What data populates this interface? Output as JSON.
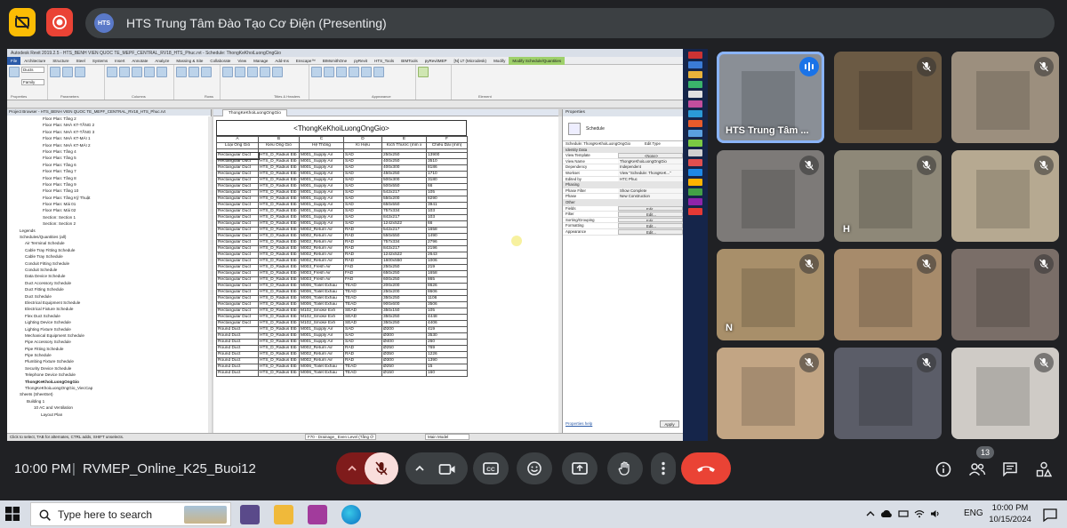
{
  "presentation": {
    "title": "HTS Trung Tâm Đào Tạo Cơ Điện (Presenting)",
    "logo_text": "HTS"
  },
  "revit": {
    "title_bar": "Autodesk Revit 2019.2.5 - HTS_BENH VIEN QUOC TE_MEPF_CENTRAL_RV18_HTS_Phuc.rvt - Schedule: ThongKeKhoiLuongOngGio",
    "tabs": [
      "File",
      "Architecture",
      "Structure",
      "Steel",
      "Systems",
      "Insert",
      "Annotate",
      "Analyze",
      "Massing & Site",
      "Collaborate",
      "View",
      "Manage",
      "Add-Ins",
      "Enscape™",
      "BIMsmithOne",
      "pyRevit",
      "HTS_Tools",
      "BIMTools",
      "pyRevitMEP",
      "[N] LT (Microdesk)",
      "Modify",
      "Modify Schedule/Quantities"
    ],
    "ribbon_groups": [
      "Properties",
      "Parameters",
      "Columns",
      "Rows",
      "Titles & Headers",
      "Appearance",
      "Element"
    ],
    "ribbon_dropdown_1": "Ducts",
    "ribbon_dropdown_2": "Family",
    "browser_header": "Project Browser - HTS_BENH VIEN QUOC TE_MEPF_CENTRAL_RV18_HTS_Phuc.rvt",
    "browser_items": [
      "Floor Plan: Tầng 2",
      "Floor Plan: NHÀ KT-TẦNG 2",
      "Floor Plan: NHÀ KT-TẦNG 3",
      "Floor Plan: NHÀ KT-MÁI 1",
      "Floor Plan: NHÀ KT-MÁI 2",
      "Floor Plan: Tầng 4",
      "Floor Plan: Tầng 5",
      "Floor Plan: Tầng 6",
      "Floor Plan: Tầng 7",
      "Floor Plan: Tầng 8",
      "Floor Plan: Tầng 9",
      "Floor Plan: Tầng 10",
      "Floor Plan: Tầng Kỹ Thuật",
      "Floor Plan: Mái 01",
      "Floor Plan: Mái 02",
      "Section: Section 1",
      "Section: Section 2",
      "Legends",
      "Schedules/Quantities (all)",
      "Air Terminal Schedule",
      "Cable Tray Fitting Schedule",
      "Cable Tray Schedule",
      "Conduit Fitting Schedule",
      "Conduit Schedule",
      "Data Device Schedule",
      "Duct Accessory Schedule",
      "Duct Fitting Schedule",
      "Duct Schedule",
      "Electrical Equipment Schedule",
      "Electrical Fixture Schedule",
      "Flex Duct Schedule",
      "Lighting Device Schedule",
      "Lighting Fixture Schedule",
      "Mechanical Equipment Schedule",
      "Pipe Accessory Schedule",
      "Pipe Fitting Schedule",
      "Pipe Schedule",
      "Plumbing Fixture Schedule",
      "Security Device Schedule",
      "Telephone Device Schedule",
      "ThongKeKhoiLuongOngGio",
      "ThongKeKhoiLuongOngGio_ViecCap",
      "Sheets (SheetSet)",
      "Building 1",
      "10 AC and Ventilation",
      "Layout Plan"
    ],
    "view_tab": "ThongKeKhoiLuongOngGio",
    "schedule_title": "<ThongKeKhoiLuongOngGio>",
    "col_letters": [
      "A",
      "B",
      "C",
      "D",
      "E",
      "F"
    ],
    "col_headers": [
      "Loại Ống Gió",
      "Kiểu Ống Gió",
      "Hệ Thống",
      "Kí Hiệu",
      "Kích Thước (mm x",
      "Chiều Dài (mm)"
    ],
    "rows": [
      [
        "Rectangular Duct",
        "HTS_D_Radius Elb",
        "M001_Supply Air",
        "SAD",
        "250x250",
        "13900"
      ],
      [
        "Rectangular Duct",
        "HTS_D_Radius Elb",
        "M001_Supply Air",
        "SAD",
        "400x250",
        "3510"
      ],
      [
        "Rectangular Duct",
        "HTS_D_Radius Elb",
        "M001_Supply Air",
        "SAD",
        "400x300",
        "8186"
      ],
      [
        "Rectangular Duct",
        "HTS_D_Radius Elb",
        "M001_Supply Air",
        "SAD",
        "450x250",
        "1710"
      ],
      [
        "Rectangular Duct",
        "HTS_D_Radius Elb",
        "M001_Supply Air",
        "SAD",
        "500x300",
        "3180"
      ],
      [
        "Rectangular Duct",
        "HTS_D_Radius Elb",
        "M001_Supply Air",
        "SAD",
        "500x550",
        "66"
      ],
      [
        "Rectangular Duct",
        "HTS_D_Radius Elb",
        "M001_Supply Air",
        "SAD",
        "542x217",
        "105"
      ],
      [
        "Rectangular Duct",
        "HTS_D_Radius Elb",
        "M001_Supply Air",
        "SAD",
        "550x200",
        "8290"
      ],
      [
        "Rectangular Duct",
        "HTS_D_Radius Elb",
        "M001_Supply Air",
        "SAD",
        "650x550",
        "3941"
      ],
      [
        "Rectangular Duct",
        "HTS_D_Radius Elb",
        "M001_Supply Air",
        "SAD",
        "757x334",
        "103"
      ],
      [
        "Rectangular Duct",
        "HTS_D_Radius Elb",
        "M001_Supply Air",
        "SAD",
        "842x217",
        "103"
      ],
      [
        "Rectangular Duct",
        "HTS_D_Radius Elb",
        "M001_Supply Air",
        "SAD",
        "1242x522",
        "66"
      ],
      [
        "Rectangular Duct",
        "HTS_D_Radius Elb",
        "M002_Return Air",
        "RAD",
        "542x217",
        "1658"
      ],
      [
        "Rectangular Duct",
        "HTS_D_Radius Elb",
        "M002_Return Air",
        "RAD",
        "550x550",
        "1490"
      ],
      [
        "Rectangular Duct",
        "HTS_D_Radius Elb",
        "M002_Return Air",
        "RAD",
        "757x334",
        "2796"
      ],
      [
        "Rectangular Duct",
        "HTS_D_Radius Elb",
        "M002_Return Air",
        "RAD",
        "842x217",
        "2196"
      ],
      [
        "Rectangular Duct",
        "HTS_D_Radius Elb",
        "M002_Return Air",
        "RAD",
        "1242x522",
        "2643"
      ],
      [
        "Rectangular Duct",
        "HTS_D_Radius Elb",
        "M002_Return Air",
        "RAD",
        "1600x550",
        "1006"
      ],
      [
        "Rectangular Duct",
        "HTS_D_Radius Elb",
        "M003_Fresh Air",
        "FAD",
        "250x250",
        "219"
      ],
      [
        "Rectangular Duct",
        "HTS_D_Radius Elb",
        "M003_Fresh Air",
        "FAD",
        "650x250",
        "1658"
      ],
      [
        "Rectangular Duct",
        "HTS_D_Radius Elb",
        "M003_Fresh Air",
        "FAD",
        "600x250",
        "865"
      ],
      [
        "Rectangular Duct",
        "HTS_D_Radius Elb",
        "M006_Toilet Exhau",
        "TEAD",
        "200x200",
        "8626"
      ],
      [
        "Rectangular Duct",
        "HTS_D_Radius Elb",
        "M006_Toilet Exhau",
        "TEAD",
        "250x200",
        "8606"
      ],
      [
        "Rectangular Duct",
        "HTS_D_Radius Elb",
        "M006_Toilet Exhau",
        "TEAD",
        "350x250",
        "1106"
      ],
      [
        "Rectangular Duct",
        "HTS_D_Radius Elb",
        "M006_Toilet Exhau",
        "TEAD",
        "900x600",
        "3506"
      ],
      [
        "Rectangular Duct",
        "HTS_D_Radius Elb",
        "M102_Smoke Exh",
        "SEAD",
        "350x150",
        "105"
      ],
      [
        "Rectangular Duct",
        "HTS_D_Radius Elb",
        "M102_Smoke Exh",
        "SEAD",
        "350x250",
        "4448"
      ],
      [
        "Rectangular Duct",
        "HTS_D_Radius Elb",
        "M102_Smoke Exh",
        "SEAD",
        "350x250",
        "4406"
      ],
      [
        "Round Duct",
        "HTS_D_Radius Elb",
        "M001_Supply Air",
        "SAD",
        "Ø200",
        "419"
      ],
      [
        "Round Duct",
        "HTS_D_Radius Elb",
        "M001_Supply Air",
        "SAD",
        "Ø300",
        "3530"
      ],
      [
        "Round Duct",
        "HTS_D_Radius Elb",
        "M001_Supply Air",
        "SAD",
        "Ø400",
        "260"
      ],
      [
        "Round Duct",
        "HTS_D_Radius Elb",
        "M002_Return Air",
        "RAD",
        "Ø250",
        "769"
      ],
      [
        "Round Duct",
        "HTS_D_Radius Elb",
        "M002_Return Air",
        "RAD",
        "Ø350",
        "1226"
      ],
      [
        "Round Duct",
        "HTS_D_Radius Elb",
        "M002_Return Air",
        "RAD",
        "Ø300",
        "1390"
      ],
      [
        "Round Duct",
        "HTS_D_Radius Elb",
        "M006_Toilet Exhau",
        "TEAD",
        "Ø250",
        "15"
      ],
      [
        "Round Duct",
        "HTS_D_Radius Elb",
        "M006_Toilet Exhau",
        "TEAD",
        "Ø150",
        "160"
      ]
    ],
    "props_header": "Properties",
    "props_type": "Schedule",
    "props_selector": "Schedule: ThongKeKhoiLuongOngGio",
    "props_edit_type": "Edit Type",
    "props_sections": {
      "identity": "Identity Data",
      "phasing": "Phasing",
      "other": "Other"
    },
    "props_identity": [
      [
        "View Template",
        "<None>"
      ],
      [
        "View Name",
        "ThongKeKhoiLuongOngGio"
      ],
      [
        "Dependency",
        "Independent"
      ],
      [
        "Workset",
        "View \"Schedule: ThongKeK...\""
      ],
      [
        "Edited by",
        "HTC Phuc"
      ]
    ],
    "props_phasing": [
      [
        "Phase Filter",
        "Show Complete"
      ],
      [
        "Phase",
        "New Construction"
      ]
    ],
    "props_other": [
      [
        "Fields",
        "Edit..."
      ],
      [
        "Filter",
        "Edit..."
      ],
      [
        "Sorting/Grouping",
        "Edit..."
      ],
      [
        "Formatting",
        "Edit..."
      ],
      [
        "Appearance",
        "Edit..."
      ]
    ],
    "props_help": "Properties help",
    "props_apply": "Apply",
    "status": "Click to select, TAB for alternates, CTRL adds, SHIFT unselects.",
    "status_view": "F70 - Drainage_ Even Level (Tầng Ở",
    "status_main": "Main Model"
  },
  "participants": [
    {
      "name": "HTS Trung Tâm ...",
      "speaking": true,
      "bg": "#8a8f96"
    },
    {
      "name": "",
      "speaking": false,
      "bg": "#6b5a44"
    },
    {
      "name": "",
      "speaking": false,
      "bg": "#9c8f7e"
    },
    {
      "name": "",
      "speaking": false,
      "bg": "#7d7a78"
    },
    {
      "name": "H",
      "speaking": false,
      "bg": "#8e8878"
    },
    {
      "name": "",
      "speaking": false,
      "bg": "#b6a991"
    },
    {
      "name": "N",
      "speaking": false,
      "bg": "#a88f6a"
    },
    {
      "name": "",
      "speaking": false,
      "bg": "#a78b6b"
    },
    {
      "name": "",
      "speaking": false,
      "bg": "#7a6e68"
    },
    {
      "name": "",
      "speaking": false,
      "bg": "#c2a584"
    },
    {
      "name": "",
      "speaking": false,
      "bg": "#5b5d68"
    },
    {
      "name": "",
      "speaking": false,
      "bg": "#cfcbc6"
    }
  ],
  "meeting": {
    "time": "10:00 PM",
    "separator": "|",
    "name": "RVMEP_Online_K25_Buoi12",
    "participant_count": "13"
  },
  "taskbar": {
    "search_placeholder": "Type here to search",
    "lang": "ENG",
    "time": "10:00 PM",
    "date": "10/15/2024"
  },
  "colors": {
    "meet_bg": "#202124",
    "end_call": "#ea4335",
    "mic_muted": "#f9dedc",
    "revit_tab": "#2a5aa8"
  }
}
